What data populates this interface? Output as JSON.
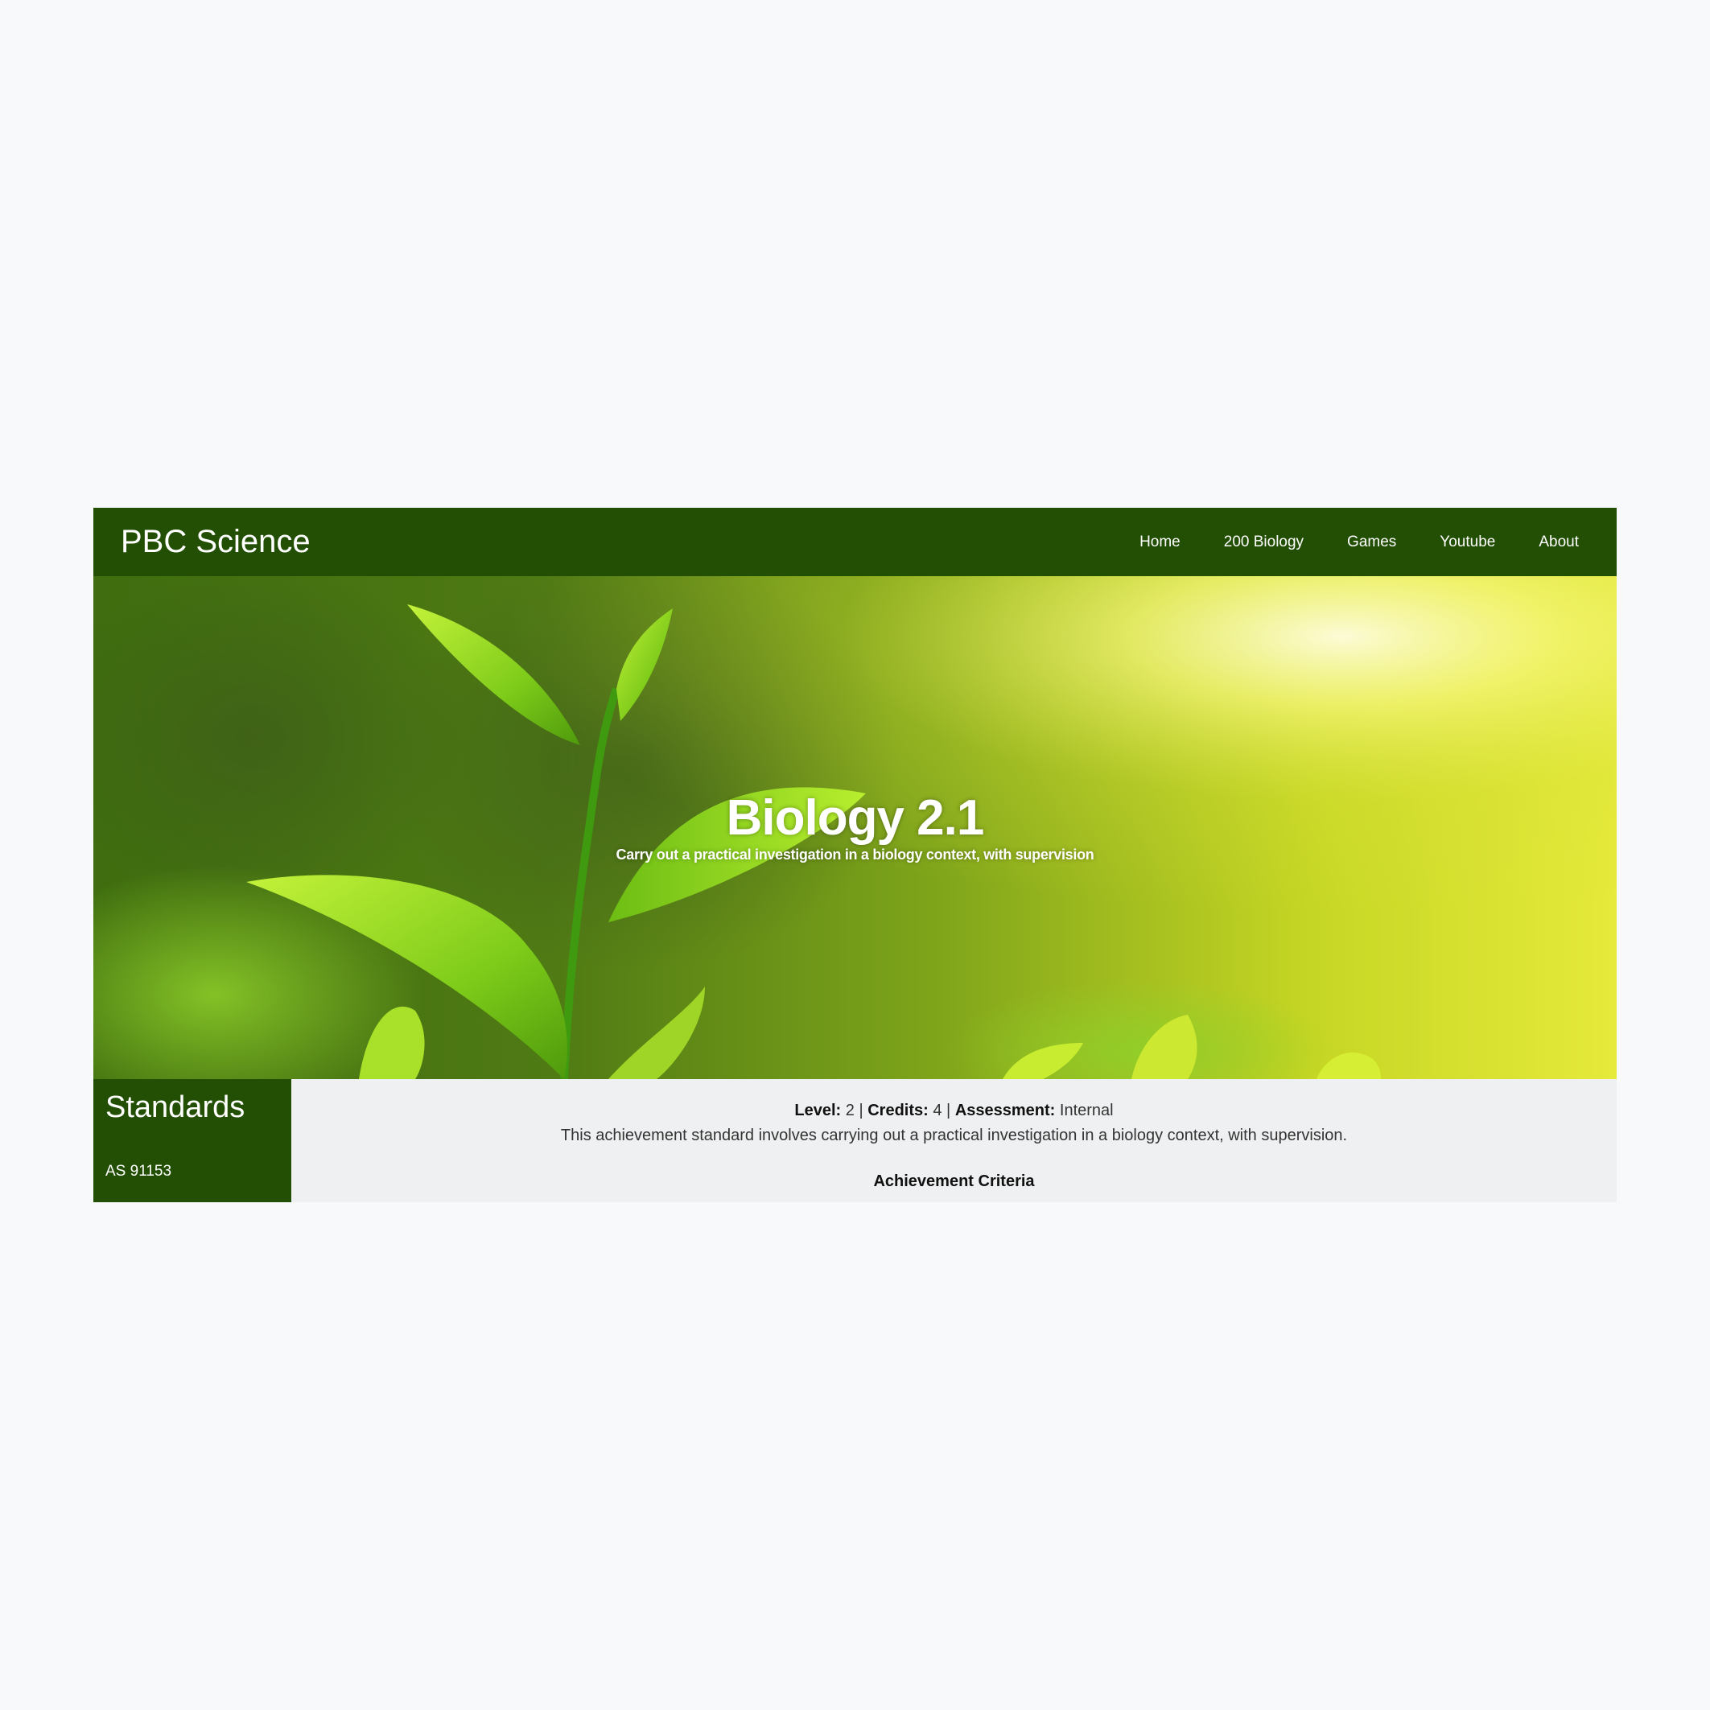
{
  "navbar": {
    "brand": "PBC Science",
    "links": [
      "Home",
      "200 Biology",
      "Games",
      "Youtube",
      "About"
    ]
  },
  "hero": {
    "title": "Biology 2.1",
    "subtitle": "Carry out a practical investigation in a biology context, with supervision"
  },
  "sidebar": {
    "title": "Standards",
    "link": "AS 91153"
  },
  "details": {
    "level_label": "Level:",
    "level_value": "2",
    "credits_label": "Credits:",
    "credits_value": "4",
    "assessment_label": "Assessment:",
    "assessment_value": "Internal",
    "separator": "|",
    "description": "This achievement standard involves carrying out a practical investigation in a biology context, with supervision.",
    "criteria_heading": "Achievement Criteria"
  },
  "colors": {
    "navbar_bg": "#224f04",
    "page_bg": "#f8f9fa",
    "content_bg": "#eff0f1"
  }
}
